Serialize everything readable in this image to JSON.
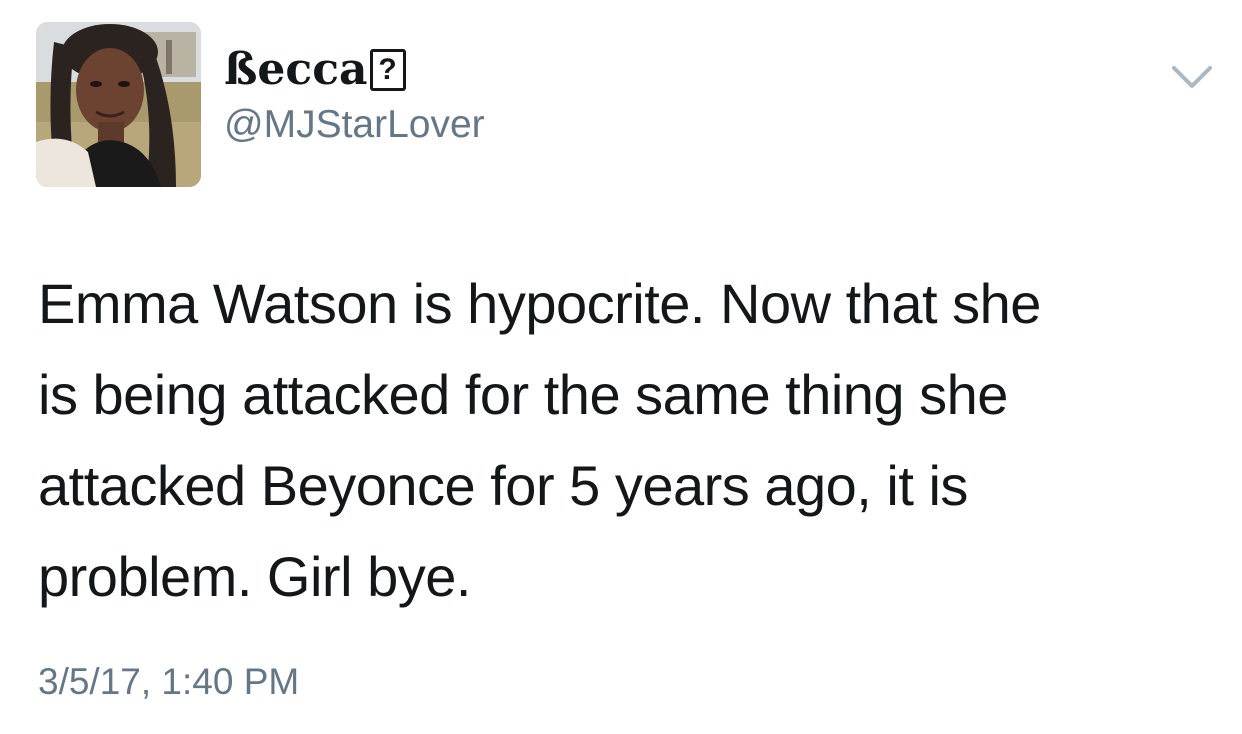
{
  "tweet": {
    "author": {
      "display_name": "ßecca",
      "name_glyph": "?",
      "handle": "@MJStarLover"
    },
    "text_lines": [
      "Emma Watson is hypocrite. Now that she",
      "is being attacked for the same thing she",
      "attacked Beyonce for 5 years ago, it is",
      "problem. Girl bye."
    ],
    "timestamp": "3/5/17, 1:40 PM",
    "menu_icon": "chevron-down-icon",
    "colors": {
      "text": "#14171a",
      "secondary_text": "#657786",
      "chevron": "#aab8c2"
    }
  }
}
